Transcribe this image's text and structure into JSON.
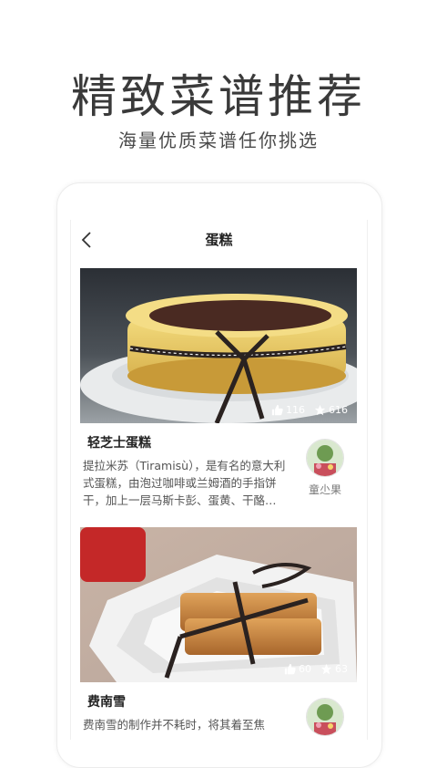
{
  "promo": {
    "title": "精致菜谱推荐",
    "subtitle": "海量优质菜谱任你挑选"
  },
  "app": {
    "nav_title": "蛋糕",
    "back_icon": "chevron-left-icon"
  },
  "recipes": [
    {
      "title": "轻芝士蛋糕",
      "description": "提拉米苏（Tiramisù），是有名的意大利式蛋糕，由泡过咖啡或兰姆酒的手指饼干，加上一层马斯卡彭、蛋黄、干酪…",
      "likes": "116",
      "favorites": "616",
      "author": "童尐果"
    },
    {
      "title": "费南雪",
      "description": "费南雪的制作并不耗时，将其着至焦",
      "likes": "60",
      "favorites": "63",
      "author": ""
    }
  ],
  "colors": {
    "title_text": "#3a3a3a",
    "stat_text": "#ffffff"
  }
}
